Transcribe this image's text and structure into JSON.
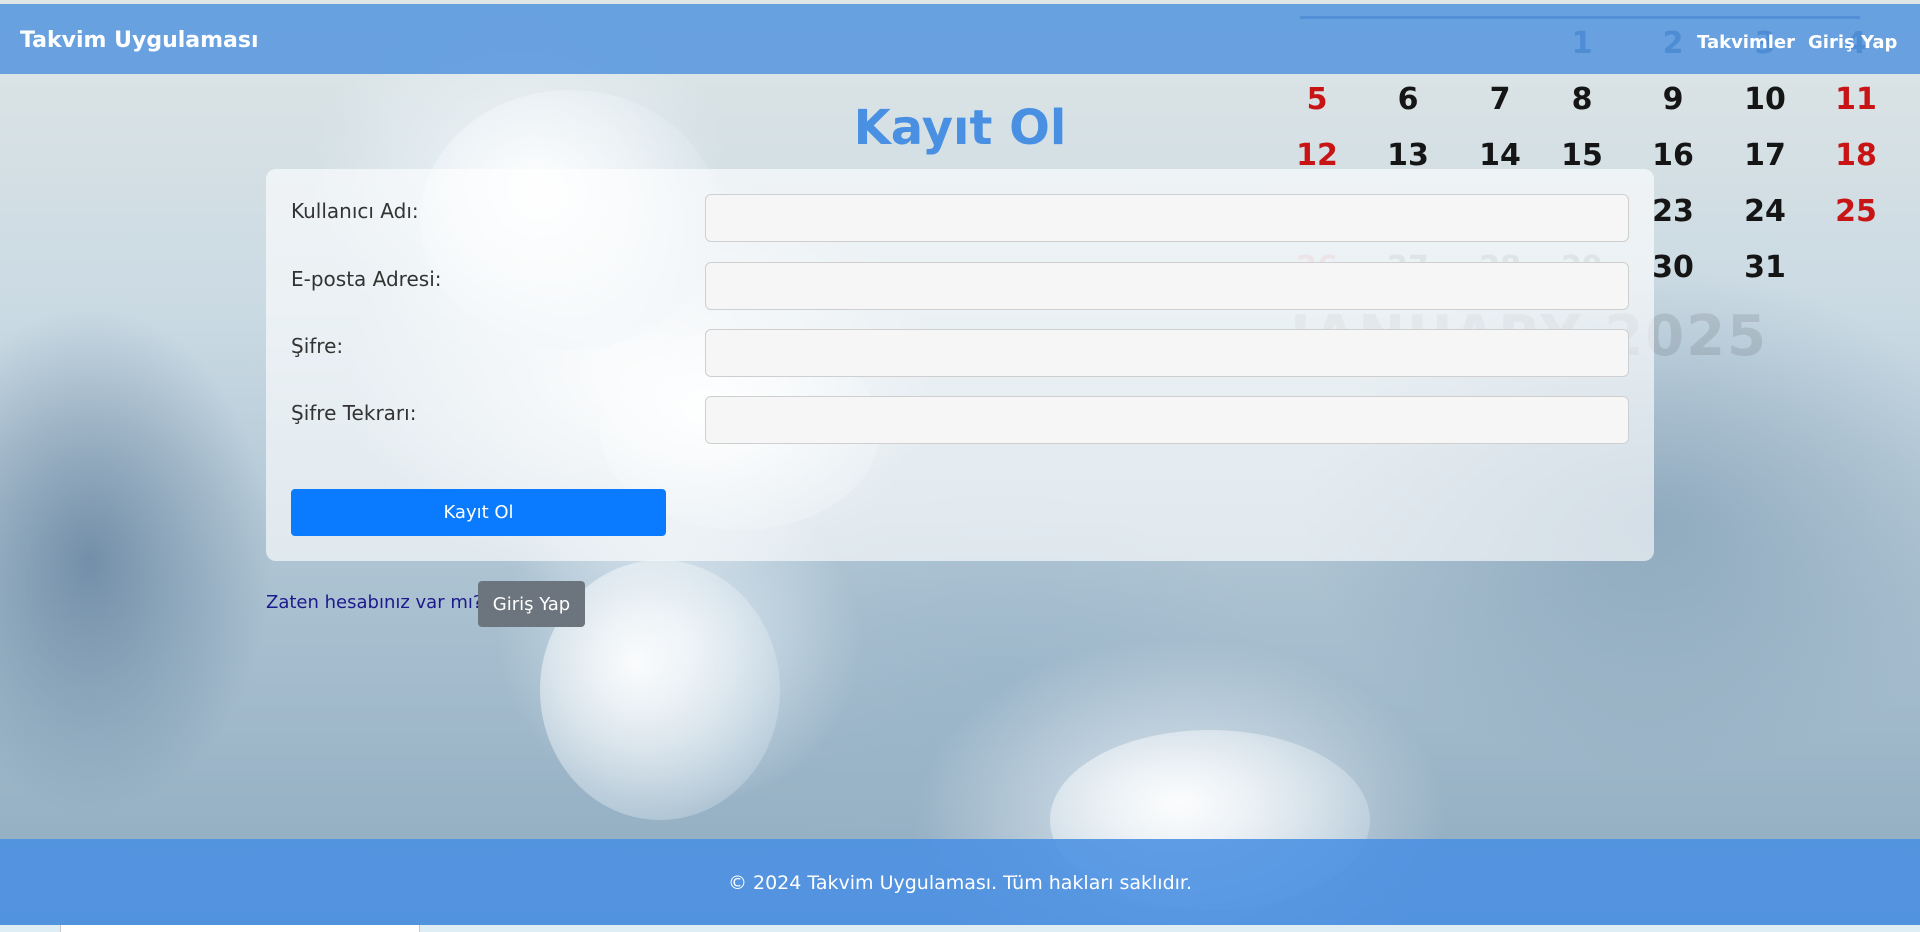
{
  "navbar": {
    "brand": "Takvim Uygulaması",
    "links": [
      "Takvimler",
      "Giriş Yap"
    ]
  },
  "page": {
    "title": "Kayıt Ol"
  },
  "form": {
    "fields": [
      {
        "label": "Kullanıcı Adı:",
        "value": ""
      },
      {
        "label": "E-posta Adresi:",
        "value": ""
      },
      {
        "label": "Şifre:",
        "value": ""
      },
      {
        "label": "Şifre Tekrarı:",
        "value": ""
      }
    ],
    "submit_label": "Kayıt Ol"
  },
  "login_prompt": {
    "text": "Zaten hesabınız var mı?",
    "button_label": "Giriş Yap"
  },
  "footer": {
    "text": "© 2024 Takvim Uygulaması. Tüm hakları saklıdır."
  },
  "background_calendar": {
    "numbers": [
      "1",
      "2",
      "3",
      "4",
      "5",
      "6",
      "7",
      "8",
      "9",
      "10",
      "11",
      "12",
      "13",
      "14",
      "15",
      "16",
      "17",
      "18",
      "23",
      "24",
      "25",
      "26",
      "27",
      "28",
      "29",
      "30",
      "31"
    ],
    "month": "JANUARY 2025"
  },
  "colors": {
    "navbar": "#4e91de",
    "title": "#4a90e2",
    "primary_button": "#0a7bff",
    "secondary_button": "#6c757d",
    "footer": "#4a90e2",
    "weekend_red": "#c81414"
  }
}
